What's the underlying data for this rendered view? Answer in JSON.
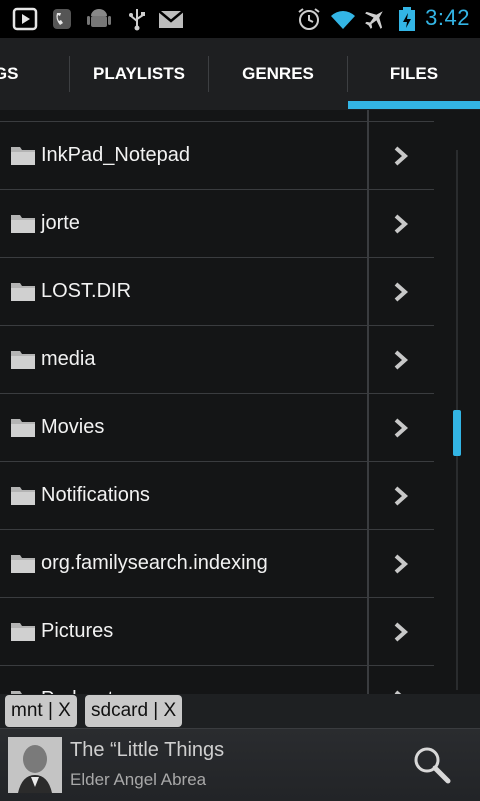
{
  "status_bar": {
    "time": "3:42",
    "icons": [
      "play-icon",
      "voicemail-icon",
      "android-icon",
      "usb-icon",
      "gmail-icon",
      "alarm-icon",
      "wifi-icon",
      "airplane-icon",
      "battery-icon"
    ]
  },
  "tabs": [
    {
      "label": "NGS",
      "selected": false
    },
    {
      "label": "PLAYLISTS",
      "selected": false
    },
    {
      "label": "GENRES",
      "selected": false
    },
    {
      "label": "FILES",
      "selected": true
    }
  ],
  "files": [
    {
      "name": "InkPad_Notepad"
    },
    {
      "name": "jorte"
    },
    {
      "name": "LOST.DIR"
    },
    {
      "name": "media"
    },
    {
      "name": "Movies"
    },
    {
      "name": "Notifications"
    },
    {
      "name": "org.familysearch.indexing"
    },
    {
      "name": "Pictures"
    },
    {
      "name": "Podcasts"
    }
  ],
  "path_chips": [
    "mnt | X",
    "sdcard | X"
  ],
  "now_playing": {
    "title": "The “Little Things",
    "artist": "Elder Angel Abrea"
  },
  "colors": {
    "accent": "#33b5e5"
  }
}
